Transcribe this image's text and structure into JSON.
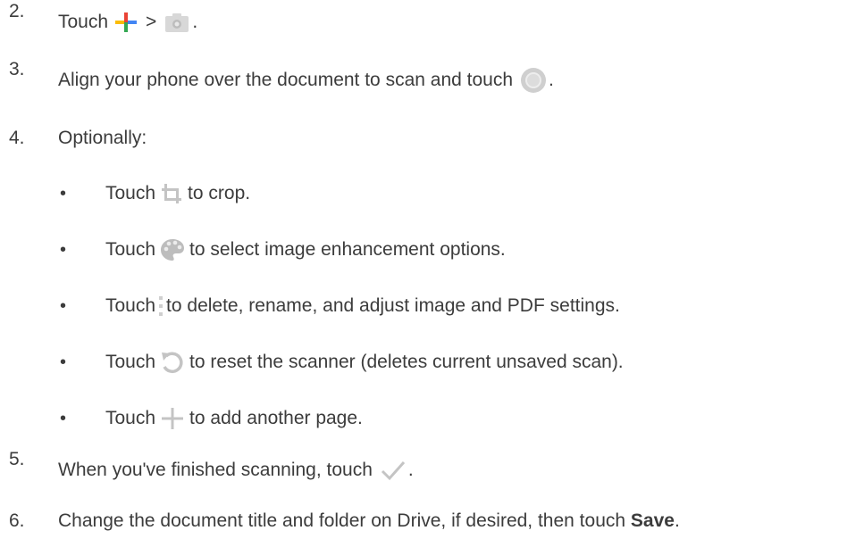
{
  "steps": [
    {
      "number": "2.",
      "pre": "Touch",
      "mid": ">",
      "post": "."
    },
    {
      "number": "3.",
      "pre": "Align your phone over the document to scan and touch",
      "post": "."
    },
    {
      "number": "4.",
      "text": "Optionally:"
    },
    {
      "number": "5.",
      "pre": "When you've finished scanning, touch",
      "post": "."
    },
    {
      "number": "6.",
      "pre": "Change the document title and folder on Drive, if desired, then touch",
      "bold": "Save",
      "post": "."
    }
  ],
  "bullets": [
    {
      "bullet": "•",
      "pre": "Touch",
      "post": "to crop.",
      "icon": "crop-icon"
    },
    {
      "bullet": "•",
      "pre": "Touch",
      "post": "to select image enhancement options.",
      "icon": "palette-icon"
    },
    {
      "bullet": "•",
      "pre": "Touch",
      "post": "to delete, rename, and adjust image and PDF settings.",
      "icon": "more-vert-icon"
    },
    {
      "bullet": "•",
      "pre": "Touch",
      "post": "to reset the scanner (deletes current unsaved scan).",
      "icon": "reset-icon"
    },
    {
      "bullet": "•",
      "pre": "Touch",
      "post": "to add another page.",
      "icon": "plus-icon"
    }
  ],
  "icons": {
    "step2_first": "colored-plus-icon",
    "step2_second": "camera-icon",
    "step3": "shutter-icon",
    "step5": "checkmark-icon"
  },
  "colors": {
    "text": "#3c3c3c",
    "google_blue": "#4285f4",
    "google_red": "#ea4335",
    "google_yellow": "#fbbc05",
    "google_green": "#34a853",
    "icon_gray": "#b8b8b8"
  }
}
